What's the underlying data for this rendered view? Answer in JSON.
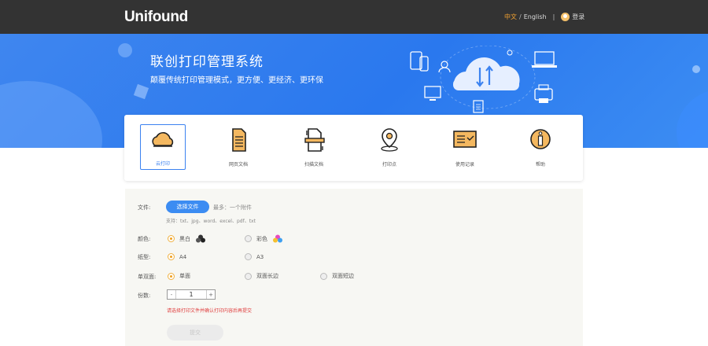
{
  "header": {
    "logo_text": "Unifound",
    "lang_zh": "中文",
    "lang_separator": "/",
    "lang_en": "English",
    "divider": "|",
    "user_name": "登录"
  },
  "banner": {
    "title": "联创打印管理系统",
    "subtitle": "颠覆传统打印管理模式，更方便、更经济、更环保"
  },
  "functions": [
    {
      "label": "云打印",
      "icon": "cloud-icon",
      "active": true
    },
    {
      "label": "网页文档",
      "icon": "document-icon",
      "active": false
    },
    {
      "label": "扫描文档",
      "icon": "scan-document-icon",
      "active": false
    },
    {
      "label": "打印点",
      "icon": "location-pin-icon",
      "active": false
    },
    {
      "label": "使用记录",
      "icon": "records-icon",
      "active": false
    },
    {
      "label": "帮助",
      "icon": "help-icon",
      "active": false
    }
  ],
  "form": {
    "file_label": "文件:",
    "choose_file": "选择文件",
    "file_note": "最多：一个附件",
    "file_types": "支持：txt、jpg、word、excel、pdf、txt",
    "color_label": "颜色:",
    "color_options": [
      "黑白",
      "彩色"
    ],
    "paper_label": "纸型:",
    "paper_options": [
      "A4",
      "A3"
    ],
    "duplex_label": "单双面:",
    "duplex_options": [
      "单面",
      "双面长边",
      "双面短边"
    ],
    "copies_label": "份数:",
    "copies_value": "1",
    "warning": "请选择打印文件并确认打印内容后再提交",
    "submit": "提交"
  },
  "colors": {
    "header_bg": "#333333",
    "banner_blue": "#2a78ee",
    "accent_blue": "#3b82f0",
    "accent_orange": "#f0a020",
    "warning_red": "#e04040"
  }
}
